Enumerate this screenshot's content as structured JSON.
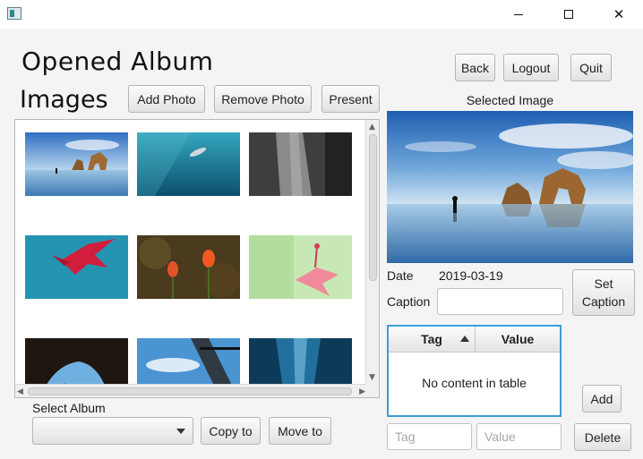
{
  "window": {
    "controls": {
      "minimize": "─",
      "maximize": "□",
      "close": "✕"
    }
  },
  "header": {
    "title": "Opened Album"
  },
  "nav": {
    "back": "Back",
    "logout": "Logout",
    "quit": "Quit"
  },
  "images": {
    "title": "Images",
    "add_photo": "Add Photo",
    "remove_photo": "Remove Photo",
    "present": "Present"
  },
  "album_select": {
    "label": "Select Album",
    "selected": "",
    "copy_to": "Copy to",
    "move_to": "Move to"
  },
  "selected_image": {
    "label": "Selected Image",
    "date_label": "Date",
    "date_value": "2019-03-19",
    "caption_label": "Caption",
    "caption_value": "",
    "set_caption": "Set Caption"
  },
  "tag_table": {
    "columns": [
      "Tag",
      "Value"
    ],
    "empty_text": "No content in table",
    "tag_placeholder": "Tag",
    "value_placeholder": "Value",
    "add": "Add",
    "delete": "Delete"
  }
}
